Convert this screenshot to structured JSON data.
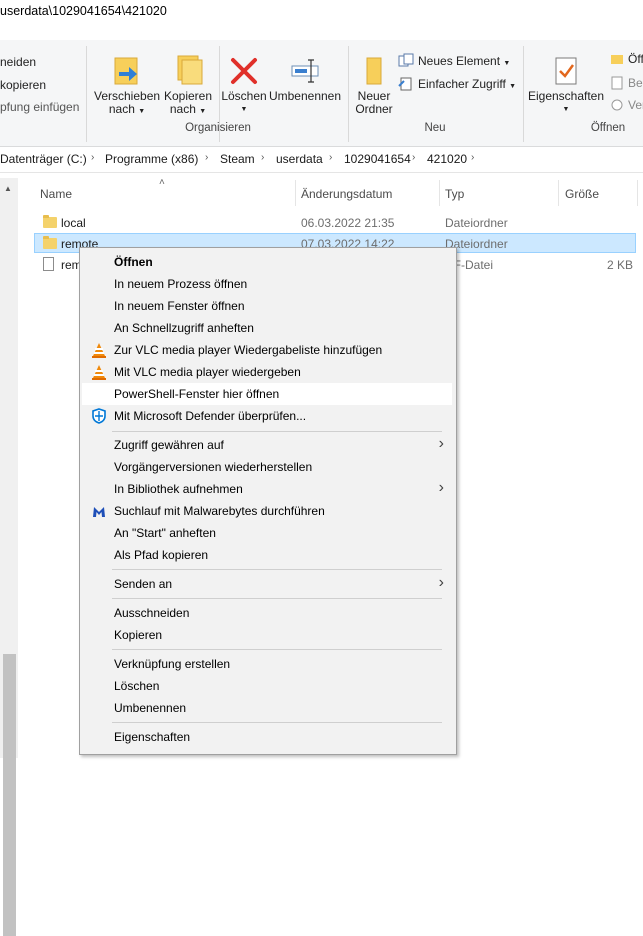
{
  "window": {
    "title": "userdata\\1029041654\\421020"
  },
  "ribbon": {
    "organize_partial": [
      "neiden",
      "kopieren",
      "pfung einfügen"
    ],
    "move_to": {
      "line1": "Verschieben",
      "line2": "nach"
    },
    "copy_to": {
      "line1": "Kopieren",
      "line2": "nach"
    },
    "delete": "Löschen",
    "rename": "Umbenennen",
    "group_organize": "Organisieren",
    "new_folder": {
      "line1": "Neuer",
      "line2": "Ordner"
    },
    "new_element": "Neues Element",
    "easy_access": "Einfacher Zugriff",
    "group_new": "Neu",
    "properties": "Eigenschaften",
    "open_partial": [
      "Öff",
      "Bea",
      "Ver"
    ],
    "group_open": "Öffnen"
  },
  "address": {
    "crumbs": [
      "Datenträger (C:)",
      "Programme (x86)",
      "Steam",
      "userdata",
      "1029041654",
      "421020"
    ]
  },
  "columns": {
    "name": "Name",
    "date": "Änderungsdatum",
    "type": "Typ",
    "size": "Größe"
  },
  "files": [
    {
      "name": "local",
      "date": "06.03.2022 21:35",
      "type": "Dateiordner",
      "size": ""
    },
    {
      "name": "remote",
      "date": "07.03.2022 14:22",
      "type": "Dateiordner",
      "size": ""
    },
    {
      "name": "rem",
      "date": "",
      "type": "DF-Datei",
      "size": "2 KB"
    }
  ],
  "context_menu": [
    {
      "label": "Öffnen",
      "bold": true
    },
    {
      "label": "In neuem Prozess öffnen"
    },
    {
      "label": "In neuem Fenster öffnen"
    },
    {
      "label": "An Schnellzugriff anheften"
    },
    {
      "label": "Zur VLC media player Wiedergabeliste hinzufügen",
      "icon": "vlc-icon"
    },
    {
      "label": "Mit VLC media player wiedergeben",
      "icon": "vlc-icon"
    },
    {
      "label": "PowerShell-Fenster hier öffnen"
    },
    {
      "label": "Mit Microsoft Defender überprüfen...",
      "icon": "defender-icon"
    },
    {
      "label": "Zugriff gewähren auf",
      "submenu": true
    },
    {
      "label": "Vorgängerversionen wiederherstellen"
    },
    {
      "label": "In Bibliothek aufnehmen",
      "submenu": true
    },
    {
      "label": "Suchlauf mit Malwarebytes durchführen",
      "icon": "malwarebytes-icon"
    },
    {
      "label": "An \"Start\" anheften"
    },
    {
      "label": "Als Pfad kopieren"
    },
    {
      "label": "Senden an",
      "submenu": true
    },
    {
      "label": "Ausschneiden"
    },
    {
      "label": "Kopieren"
    },
    {
      "label": "Verknüpfung erstellen"
    },
    {
      "label": "Löschen"
    },
    {
      "label": "Umbenennen"
    },
    {
      "label": "Eigenschaften"
    }
  ],
  "colors": {
    "selection": "#cce8ff",
    "selection_border": "#99d1ff",
    "menu_bg": "#f2f2f2",
    "accent": "#0078d7"
  }
}
